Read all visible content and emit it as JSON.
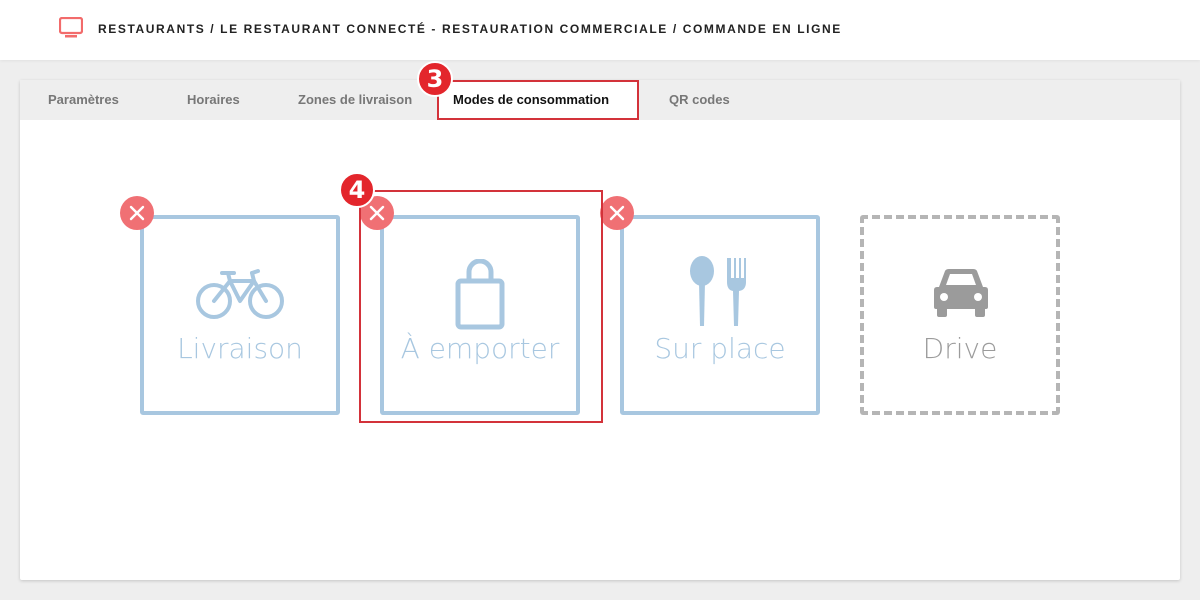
{
  "header": {
    "icon": "monitor-icon",
    "accent": "#f26b6b",
    "breadcrumb": "RESTAURANTS / LE RESTAURANT CONNECTÉ - RESTAURATION COMMERCIALE / COMMANDE EN LIGNE"
  },
  "tabs": [
    {
      "label": "Paramètres"
    },
    {
      "label": "Horaires"
    },
    {
      "label": "Zones de livraison"
    },
    {
      "label": "Modes de consommation",
      "active": true
    },
    {
      "label": "QR codes"
    }
  ],
  "annotations": {
    "tab_step": "3",
    "tile_step": "4",
    "color": "#e3262c"
  },
  "modes": [
    {
      "label": "Livraison",
      "icon": "bicycle-icon",
      "enabled": true
    },
    {
      "label": "À emporter",
      "icon": "shopping-bag-icon",
      "enabled": true
    },
    {
      "label": "Sur place",
      "icon": "spoon-fork-icon",
      "enabled": true
    },
    {
      "label": "Drive",
      "icon": "car-icon",
      "enabled": false
    }
  ],
  "colors": {
    "tile_enabled": "#a8c7e0",
    "tile_disabled": "#b5b5b5",
    "remove_button": "#f07074"
  }
}
